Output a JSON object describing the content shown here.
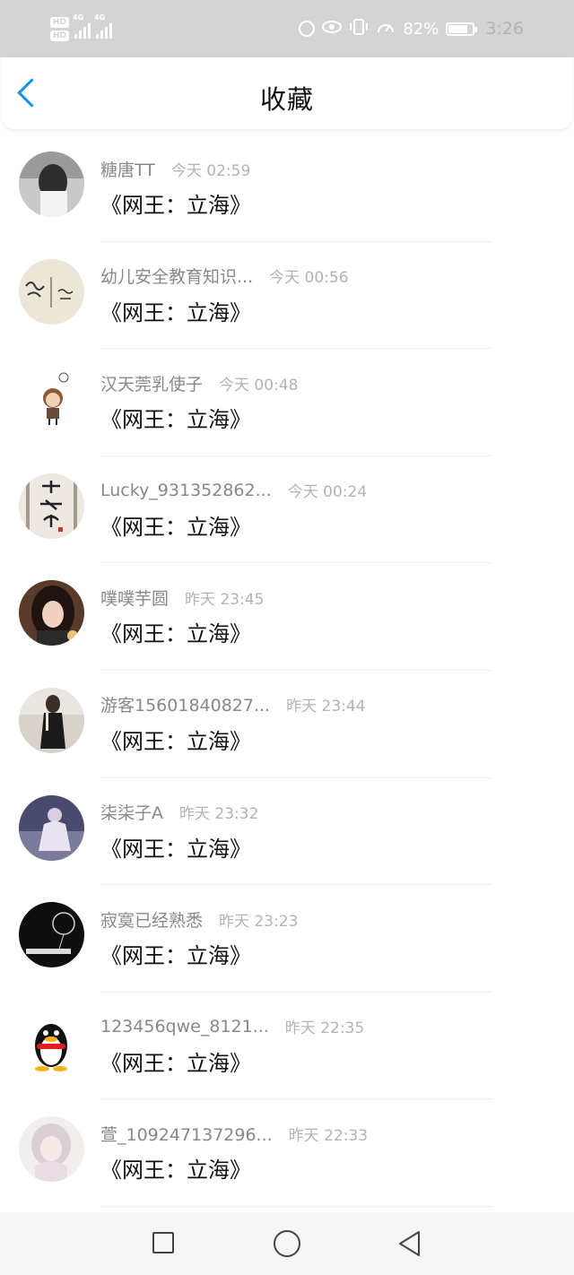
{
  "status_bar": {
    "hd1": "HD",
    "hd2": "HD",
    "net1": "4G",
    "net2": "4G",
    "battery_percent": "82%",
    "battery_level": 0.82,
    "time": "3:26",
    "icons": [
      "nfc-icon",
      "eye-icon",
      "vibrate-icon",
      "speed-icon",
      "battery-icon"
    ]
  },
  "header": {
    "title": "收藏",
    "back_icon": "chevron-left-icon",
    "accent_color": "#1a90e8"
  },
  "favorites": [
    {
      "name": "糖唐TT",
      "time": "今天 02:59",
      "comment": "《网王：立海》"
    },
    {
      "name": "幼儿安全教育知识...",
      "time": "今天 00:56",
      "comment": "《网王：立海》"
    },
    {
      "name": "汉天莞乳使子",
      "time": "今天 00:48",
      "comment": "《网王：立海》"
    },
    {
      "name": "Lucky_931352862...",
      "time": "今天 00:24",
      "comment": "《网王：立海》"
    },
    {
      "name": "噗噗芋圆",
      "time": "昨天 23:45",
      "comment": "《网王：立海》"
    },
    {
      "name": "游客15601840827...",
      "time": "昨天 23:44",
      "comment": "《网王：立海》"
    },
    {
      "name": "柒柒子A",
      "time": "昨天 23:32",
      "comment": "《网王：立海》"
    },
    {
      "name": "寂寞已经熟悉",
      "time": "昨天 23:23",
      "comment": "《网王：立海》"
    },
    {
      "name": "123456qwe_8121...",
      "time": "昨天 22:35",
      "comment": "《网王：立海》"
    },
    {
      "name": "萱_109247137296...",
      "time": "昨天 22:33",
      "comment": "《网王：立海》"
    }
  ],
  "nav_bar": {
    "icons": [
      "recent-apps-icon",
      "home-icon",
      "back-icon"
    ]
  }
}
